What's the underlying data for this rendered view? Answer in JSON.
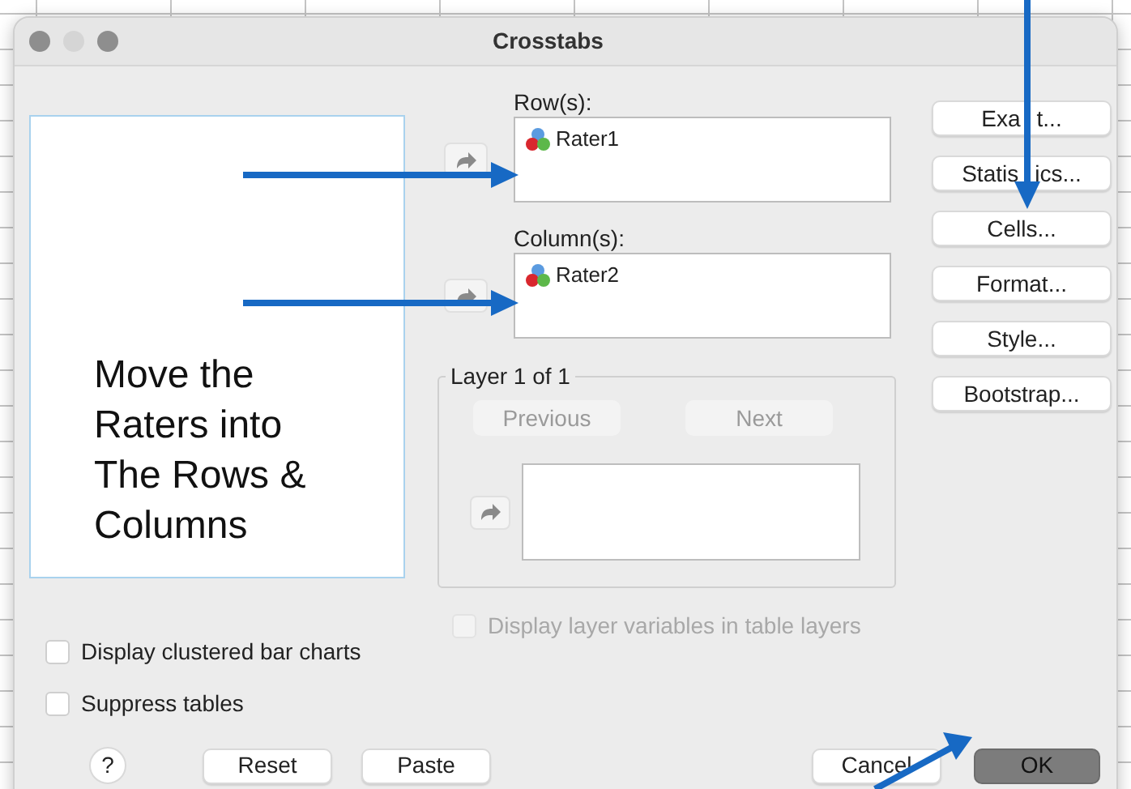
{
  "window": {
    "title": "Crosstabs"
  },
  "instruction": "Move the Raters into The Rows & Columns",
  "fields": [
    {
      "label": "Row(s):",
      "items": [
        "Rater1"
      ]
    },
    {
      "label": "Column(s):",
      "items": [
        "Rater2"
      ]
    }
  ],
  "layer": {
    "legend": "Layer 1 of 1",
    "buttons": [
      {
        "label": "Previous",
        "disabled": true
      },
      {
        "label": "Next",
        "disabled": true
      }
    ]
  },
  "layer_option": {
    "label": "Display layer variables in table layers",
    "checked": false,
    "disabled": true
  },
  "side_buttons": [
    [
      "Exa",
      "t..."
    ],
    [
      "Statis",
      "ics..."
    ],
    [
      "Cells..."
    ],
    [
      "Format..."
    ],
    [
      "Style..."
    ],
    [
      "Bootstrap..."
    ]
  ],
  "options": [
    {
      "label": "Display clustered bar charts",
      "checked": false
    },
    {
      "label": "Suppress tables",
      "checked": false
    }
  ],
  "footer": {
    "help": "?",
    "left": [
      "Reset",
      "Paste"
    ],
    "cancel": "Cancel",
    "ok": "OK"
  }
}
